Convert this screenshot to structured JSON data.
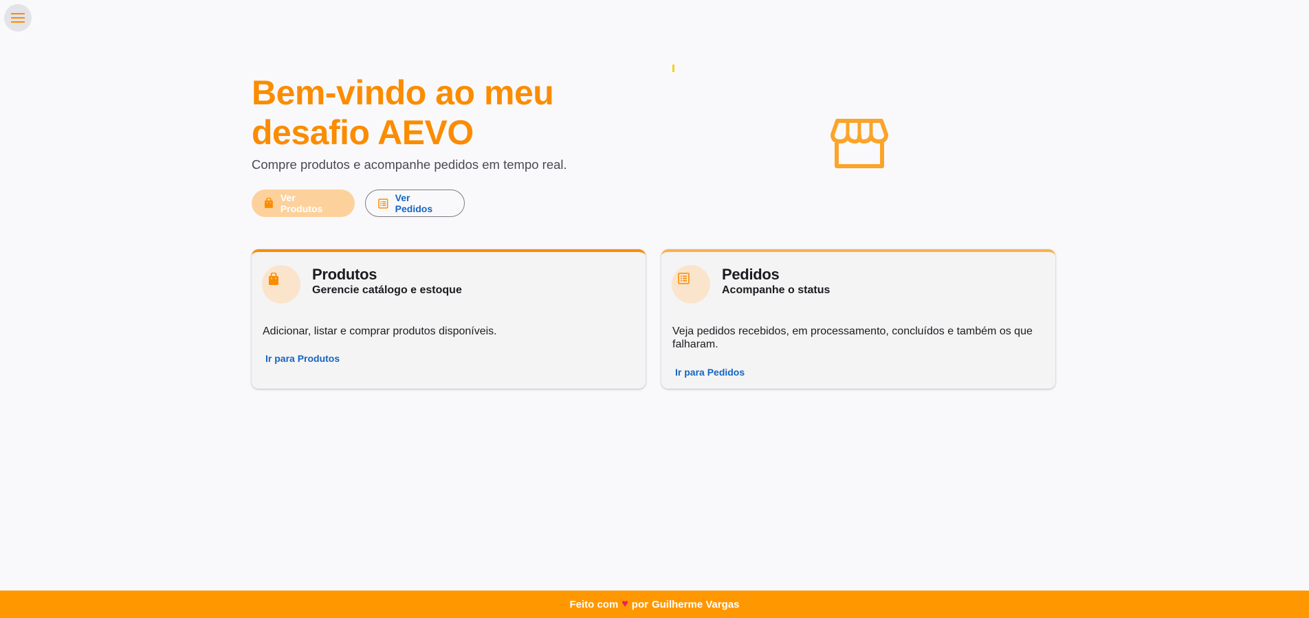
{
  "nav": {
    "menu_icon": "menu-icon"
  },
  "hero": {
    "title_line1": "Bem-vindo ao meu",
    "title_line2": "desafio AEVO",
    "subtitle": "Compre produtos e acompanhe pedidos em tempo real.",
    "btn_products": "Ver Produtos",
    "btn_orders": "Ver Pedidos",
    "illustration_icon": "storefront-icon"
  },
  "cards": {
    "products": {
      "icon": "shopping-bag-icon",
      "title": "Produtos",
      "subtitle": "Gerencie catálogo e estoque",
      "description": "Adicionar, listar e comprar produtos disponíveis.",
      "link": "Ir para Produtos"
    },
    "orders": {
      "icon": "receipt-list-icon",
      "title": "Pedidos",
      "subtitle": "Acompanhe o status",
      "description": "Veja pedidos recebidos, em processamento, concluídos e também os que falharam.",
      "link": "Ir para Pedidos"
    }
  },
  "footer": {
    "prefix": "Feito com",
    "heart": "♥",
    "by": "por",
    "author": "Guilherme Vargas"
  },
  "colors": {
    "accent": "#fb8c00",
    "link": "#1565c0",
    "footer_bg": "#ff9800",
    "heart": "#e91e63"
  }
}
